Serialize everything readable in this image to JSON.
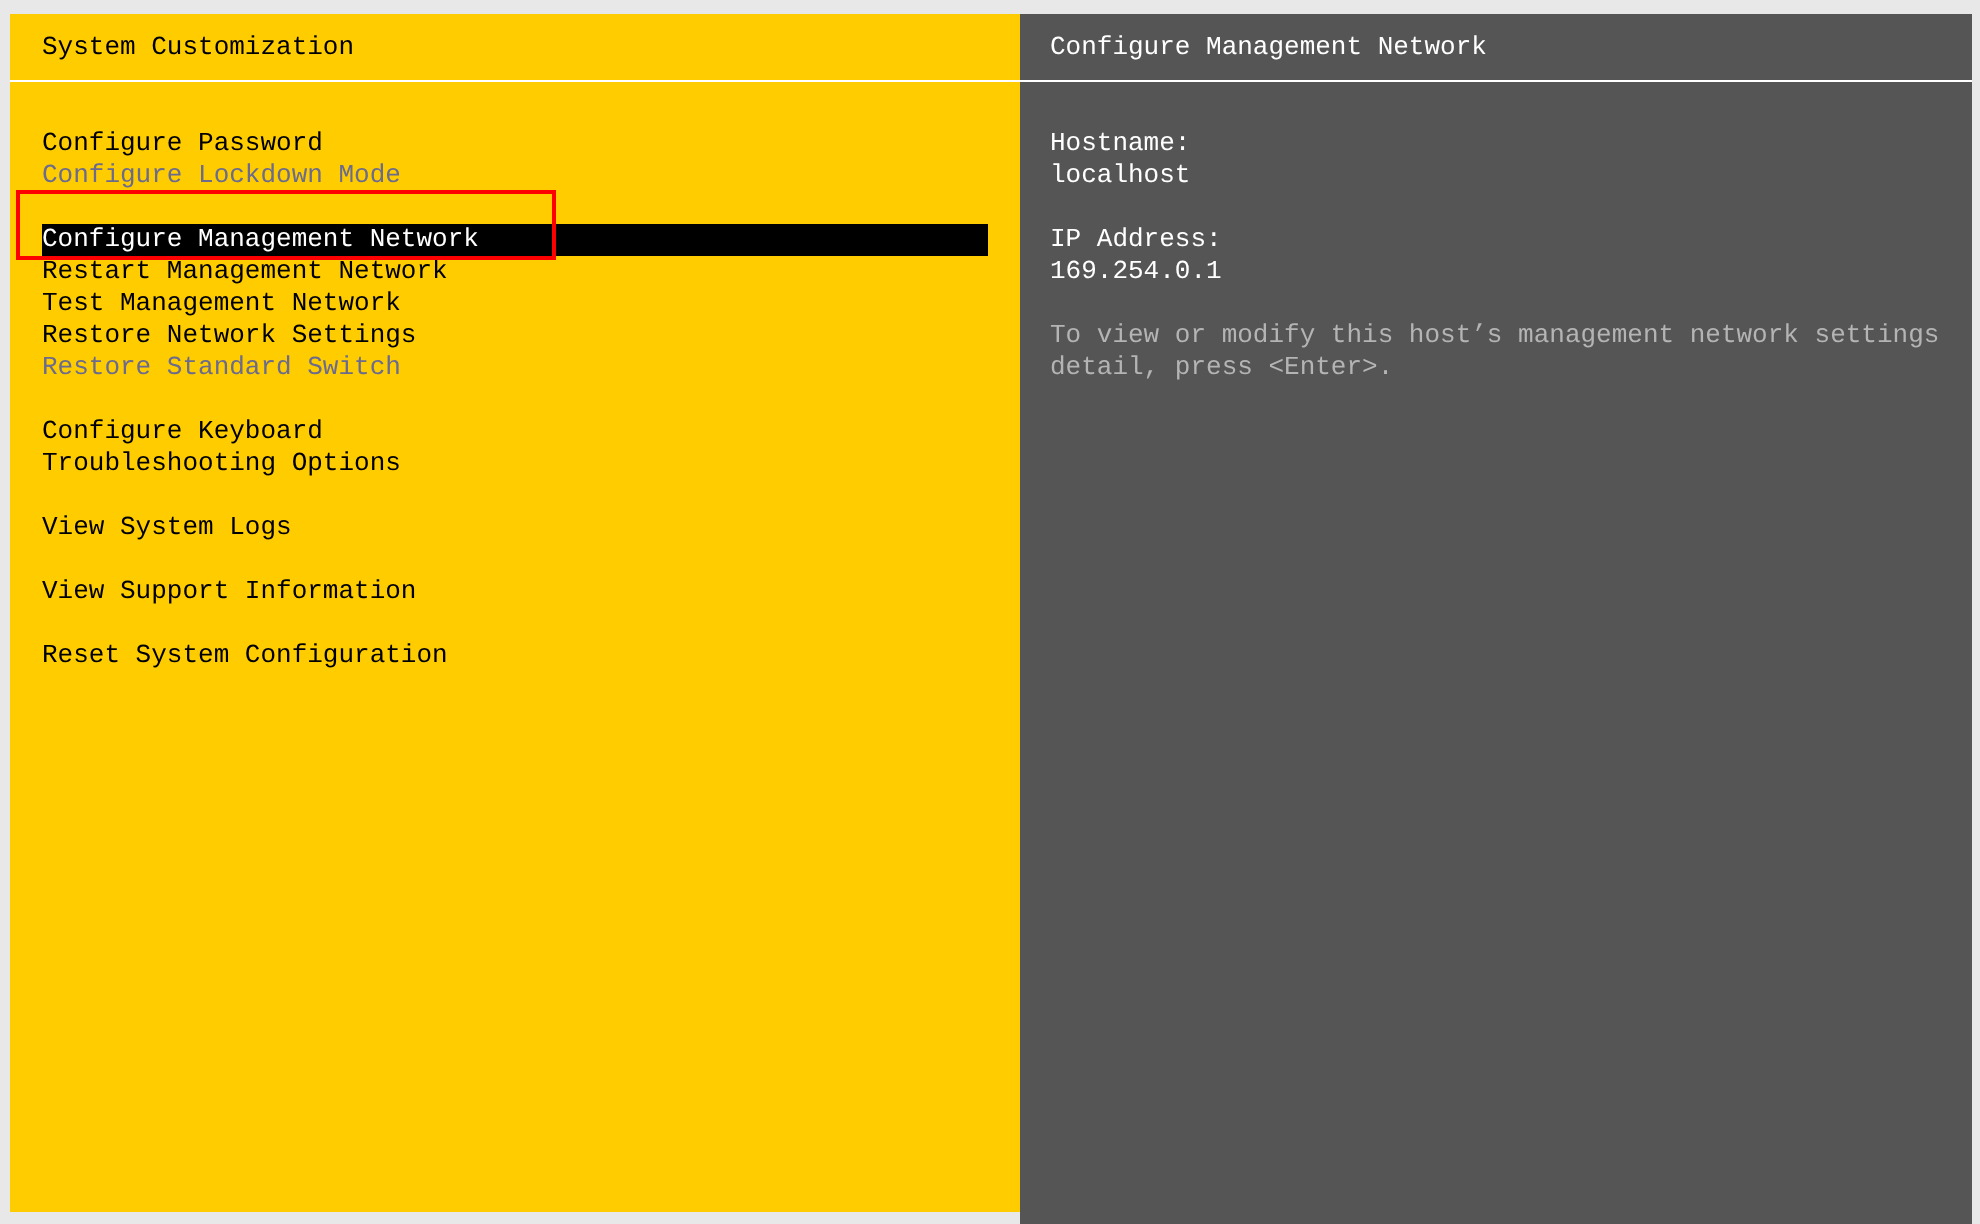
{
  "left_panel": {
    "title": "System Customization",
    "groups": [
      {
        "items": [
          {
            "label": "Configure Password",
            "disabled": false,
            "selected": false
          },
          {
            "label": "Configure Lockdown Mode",
            "disabled": true,
            "selected": false
          }
        ]
      },
      {
        "items": [
          {
            "label": "Configure Management Network",
            "disabled": false,
            "selected": true
          },
          {
            "label": "Restart Management Network",
            "disabled": false,
            "selected": false
          },
          {
            "label": "Test Management Network",
            "disabled": false,
            "selected": false
          },
          {
            "label": "Restore Network Settings",
            "disabled": false,
            "selected": false
          },
          {
            "label": "Restore Standard Switch",
            "disabled": true,
            "selected": false
          }
        ]
      },
      {
        "items": [
          {
            "label": "Configure Keyboard",
            "disabled": false,
            "selected": false
          },
          {
            "label": "Troubleshooting Options",
            "disabled": false,
            "selected": false
          }
        ]
      },
      {
        "items": [
          {
            "label": "View System Logs",
            "disabled": false,
            "selected": false
          }
        ]
      },
      {
        "items": [
          {
            "label": "View Support Information",
            "disabled": false,
            "selected": false
          }
        ]
      },
      {
        "items": [
          {
            "label": "Reset System Configuration",
            "disabled": false,
            "selected": false
          }
        ]
      }
    ]
  },
  "right_panel": {
    "title": "Configure Management Network",
    "fields": [
      {
        "label": "Hostname:",
        "value": "localhost"
      },
      {
        "label": "IP Address:",
        "value": "169.254.0.1"
      }
    ],
    "description_lines": [
      "To view or modify this host’s management network settings",
      "detail, press <Enter>."
    ]
  }
}
